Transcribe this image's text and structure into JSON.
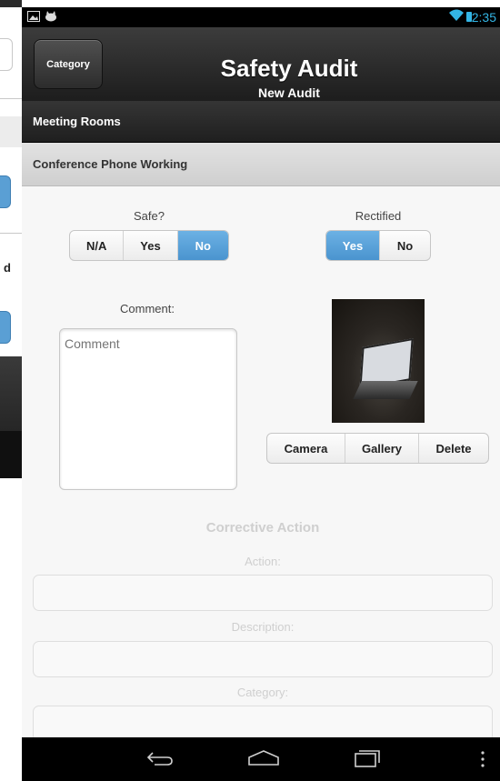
{
  "status": {
    "time": "2:35",
    "colors": {
      "accent": "#33b5e5"
    }
  },
  "header": {
    "category_button": "Category",
    "title": "Safety Audit",
    "subtitle": "New Audit"
  },
  "section": "Meeting Rooms",
  "item": "Conference Phone Working",
  "safe": {
    "label": "Safe?",
    "options": [
      "N/A",
      "Yes",
      "No"
    ],
    "selected": "No"
  },
  "rectified": {
    "label": "Rectified",
    "options": [
      "Yes",
      "No"
    ],
    "selected": "Yes"
  },
  "comment": {
    "label": "Comment:",
    "placeholder": "Comment"
  },
  "photo_buttons": [
    "Camera",
    "Gallery",
    "Delete"
  ],
  "corrective": {
    "title": "Corrective Action",
    "action_label": "Action:",
    "description_label": "Description:",
    "category_label": "Category:"
  },
  "background_screen": {
    "partial_letter": "d"
  },
  "colors": {
    "selected": "#4a94cf",
    "header_dark": "#1d1d1d"
  }
}
